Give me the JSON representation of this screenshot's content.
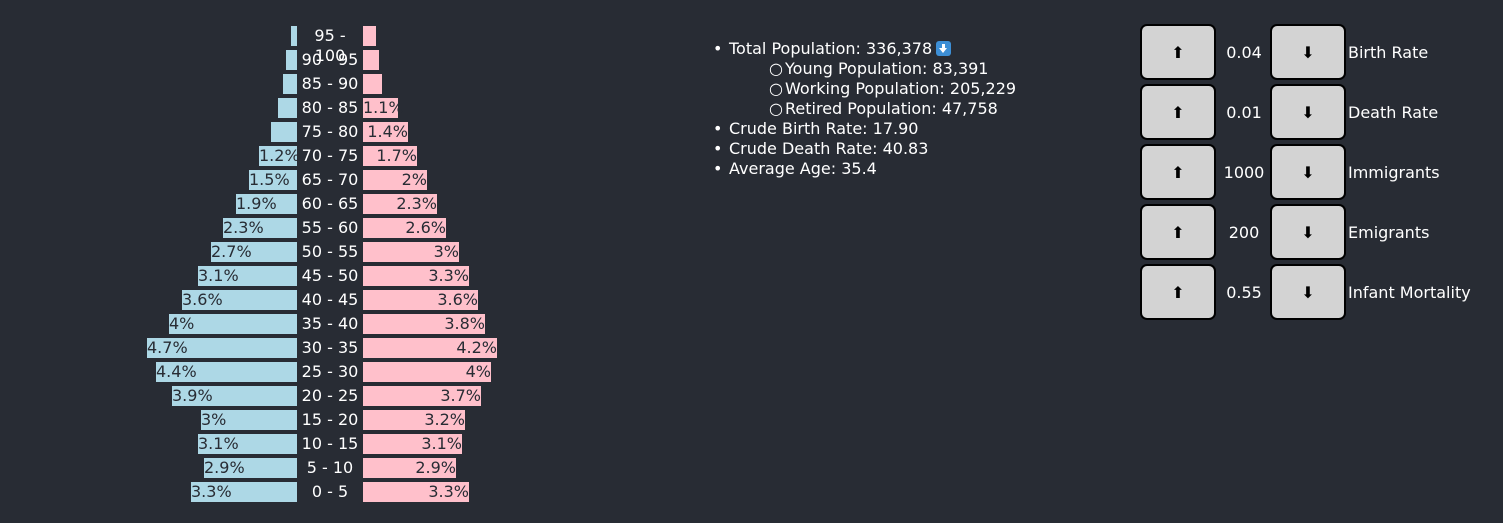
{
  "pyramid": [
    {
      "age": "95 - 100",
      "male": 0.2,
      "female": 0.4,
      "male_label": "",
      "female_label": ""
    },
    {
      "age": "90 - 95",
      "male": 0.35,
      "female": 0.5,
      "male_label": "",
      "female_label": ""
    },
    {
      "age": "85 - 90",
      "male": 0.45,
      "female": 0.6,
      "male_label": "",
      "female_label": ""
    },
    {
      "age": "80 - 85",
      "male": 0.6,
      "female": 1.1,
      "male_label": "",
      "female_label": "1.1%"
    },
    {
      "age": "75 - 80",
      "male": 0.8,
      "female": 1.4,
      "male_label": "",
      "female_label": "1.4%"
    },
    {
      "age": "70 - 75",
      "male": 1.2,
      "female": 1.7,
      "male_label": "1.2%",
      "female_label": "1.7%"
    },
    {
      "age": "65 - 70",
      "male": 1.5,
      "female": 2.0,
      "male_label": "1.5%",
      "female_label": "2%"
    },
    {
      "age": "60 - 65",
      "male": 1.9,
      "female": 2.3,
      "male_label": "1.9%",
      "female_label": "2.3%"
    },
    {
      "age": "55 - 60",
      "male": 2.3,
      "female": 2.6,
      "male_label": "2.3%",
      "female_label": "2.6%"
    },
    {
      "age": "50 - 55",
      "male": 2.7,
      "female": 3.0,
      "male_label": "2.7%",
      "female_label": "3%"
    },
    {
      "age": "45 - 50",
      "male": 3.1,
      "female": 3.3,
      "male_label": "3.1%",
      "female_label": "3.3%"
    },
    {
      "age": "40 - 45",
      "male": 3.6,
      "female": 3.6,
      "male_label": "3.6%",
      "female_label": "3.6%"
    },
    {
      "age": "35 - 40",
      "male": 4.0,
      "female": 3.8,
      "male_label": "4%",
      "female_label": "3.8%"
    },
    {
      "age": "30 - 35",
      "male": 4.7,
      "female": 4.2,
      "male_label": "4.7%",
      "female_label": "4.2%"
    },
    {
      "age": "25 - 30",
      "male": 4.4,
      "female": 4.0,
      "male_label": "4.4%",
      "female_label": "4%"
    },
    {
      "age": "20 - 25",
      "male": 3.9,
      "female": 3.7,
      "male_label": "3.9%",
      "female_label": "3.7%"
    },
    {
      "age": "15 - 20",
      "male": 3.0,
      "female": 3.2,
      "male_label": "3%",
      "female_label": "3.2%"
    },
    {
      "age": "10 - 15",
      "male": 3.1,
      "female": 3.1,
      "male_label": "3.1%",
      "female_label": "3.1%"
    },
    {
      "age": "5 - 10",
      "male": 2.9,
      "female": 2.9,
      "male_label": "2.9%",
      "female_label": "2.9%"
    },
    {
      "age": "0 - 5",
      "male": 3.3,
      "female": 3.3,
      "male_label": "3.3%",
      "female_label": "3.3%"
    }
  ],
  "stats": {
    "total": "Total Population: 336,378",
    "young": "Young Population: 83,391",
    "working": "Working Population: 205,229",
    "retired": "Retired Population: 47,758",
    "birth_rate": "Crude Birth Rate: 17.90",
    "death_rate": "Crude Death Rate: 40.83",
    "avg_age": "Average Age: 35.4",
    "trend_icon": "down-arrow-icon"
  },
  "bullets": {
    "main": "•",
    "sub": "○"
  },
  "controls": [
    {
      "name": "Birth Rate",
      "value": "0.04",
      "up": "⬆",
      "down": "⬇"
    },
    {
      "name": "Death Rate",
      "value": "0.01",
      "up": "⬆",
      "down": "⬇"
    },
    {
      "name": "Immigrants",
      "value": "1000",
      "up": "⬆",
      "down": "⬇"
    },
    {
      "name": "Emigrants",
      "value": "200",
      "up": "⬆",
      "down": "⬇"
    },
    {
      "name": "Infant Mortality",
      "value": "0.55",
      "up": "⬆",
      "down": "⬇"
    }
  ],
  "colors": {
    "background": "#282c34",
    "male": "#add8e6",
    "female": "#ffc0cb",
    "button": "#d3d3d3",
    "badge": "#3d8fd6"
  }
}
